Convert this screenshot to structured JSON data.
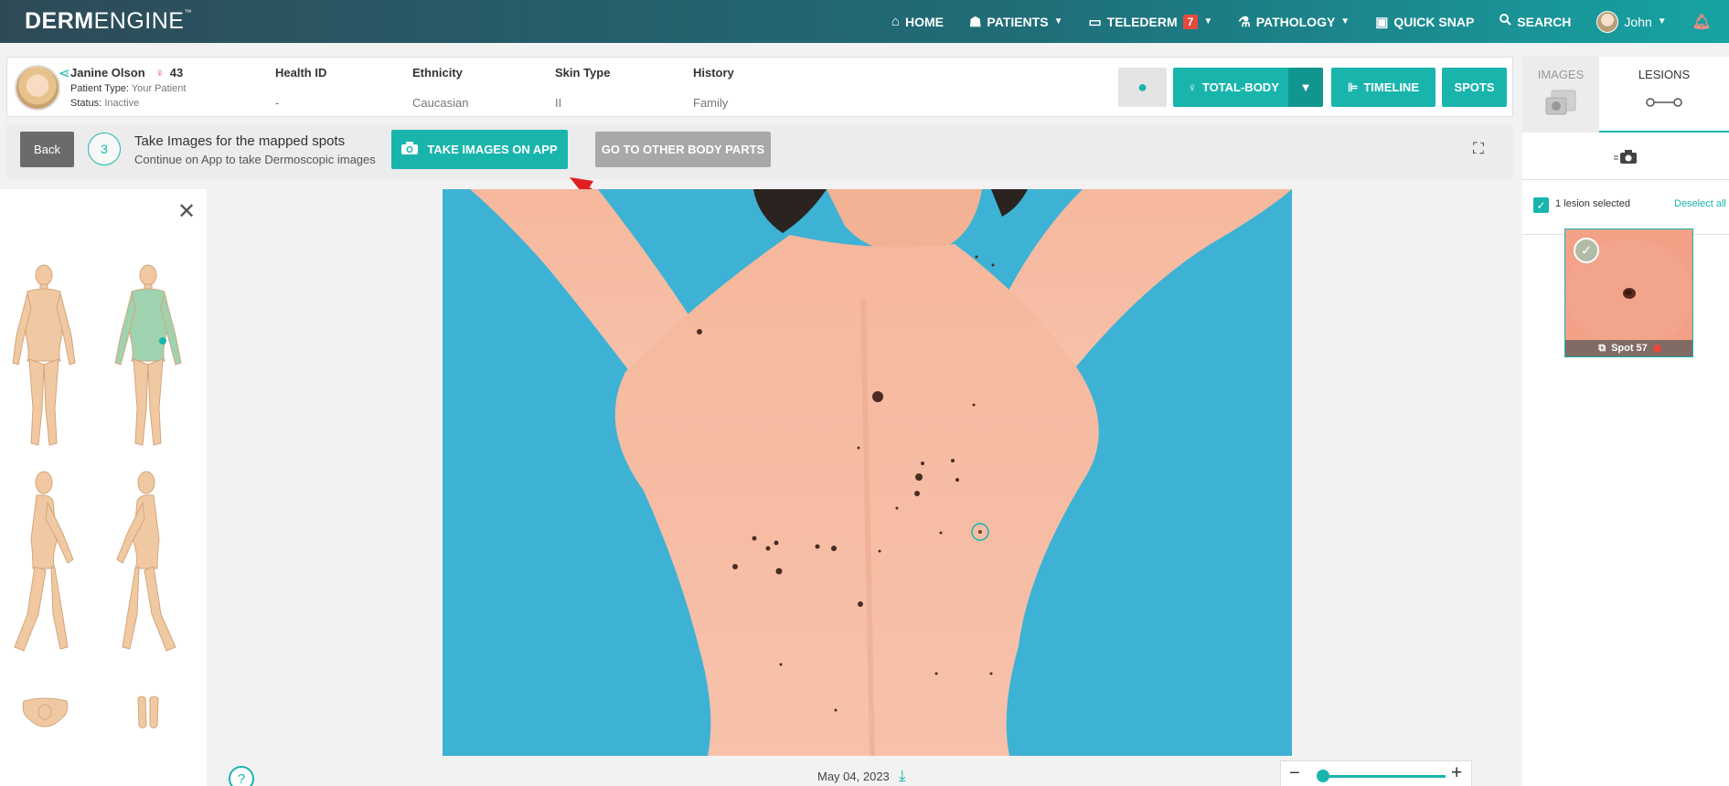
{
  "app": {
    "logo_bold": "DERM",
    "logo_rest": "ENGINE",
    "logo_tm": "™"
  },
  "nav": {
    "home": "HOME",
    "patients": "PATIENTS",
    "telederm": "TELEDERM",
    "telederm_badge": "7",
    "pathology": "PATHOLOGY",
    "quick_snap": "QUICK SNAP",
    "search": "SEARCH",
    "user": "John"
  },
  "patient": {
    "name": "Janine Olson",
    "age": "43",
    "type_label": "Patient Type:",
    "type_value": "Your Patient",
    "status_label": "Status:",
    "status_value": "Inactive",
    "columns": [
      {
        "header": "Health ID",
        "value": "-"
      },
      {
        "header": "Ethnicity",
        "value": "Caucasian"
      },
      {
        "header": "Skin Type",
        "value": "II"
      },
      {
        "header": "History",
        "value": "Family"
      }
    ]
  },
  "toolbar": {
    "total_body": "TOTAL-BODY",
    "timeline": "TIMELINE",
    "spots": "SPOTS"
  },
  "step": {
    "back": "Back",
    "number": "3",
    "title": "Take Images for the mapped spots",
    "subtitle": "Continue on App to take Dermoscopic images",
    "take_images": "TAKE IMAGES ON APP",
    "other_parts": "GO TO OTHER BODY PARTS"
  },
  "viewer": {
    "date": "May 04, 2023",
    "zoom_level": 0.05
  },
  "right": {
    "tab_images": "IMAGES",
    "tab_lesions": "LESIONS",
    "selected_text": "1 lesion selected",
    "deselect": "Deselect all",
    "spot_label": "Spot 57"
  },
  "colors": {
    "accent": "#19b5ad",
    "alert": "#e64a3d"
  }
}
